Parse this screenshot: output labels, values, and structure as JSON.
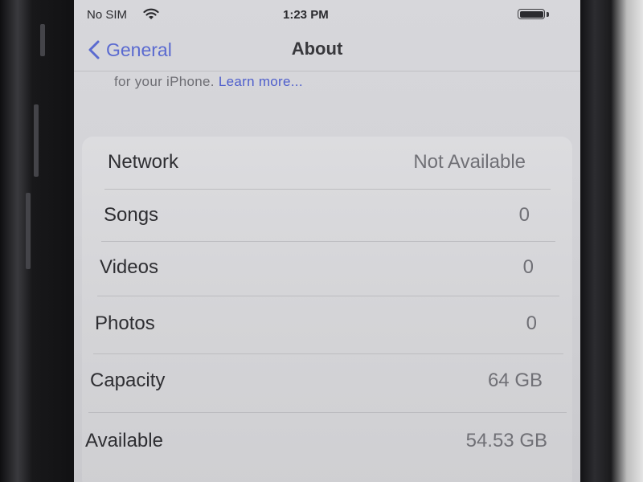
{
  "status_bar": {
    "carrier": "No SIM",
    "time": "1:23 PM",
    "wifi_icon": "wifi-icon",
    "battery_icon": "battery-icon"
  },
  "nav": {
    "back_label": "General",
    "back_icon": "chevron-left-icon",
    "title": "About"
  },
  "footnote": {
    "text": "for your iPhone.",
    "link": "Learn more..."
  },
  "rows": [
    {
      "label": "Network",
      "value": "Not Available"
    },
    {
      "label": "Songs",
      "value": "0"
    },
    {
      "label": "Videos",
      "value": "0"
    },
    {
      "label": "Photos",
      "value": "0"
    },
    {
      "label": "Capacity",
      "value": "64 GB"
    },
    {
      "label": "Available",
      "value": "54.53 GB"
    }
  ],
  "colors": {
    "accent": "#5a6ad0",
    "screen_background": "#d4d4d8",
    "group_background": "#dcdcdf",
    "secondary_text": "#707076"
  }
}
